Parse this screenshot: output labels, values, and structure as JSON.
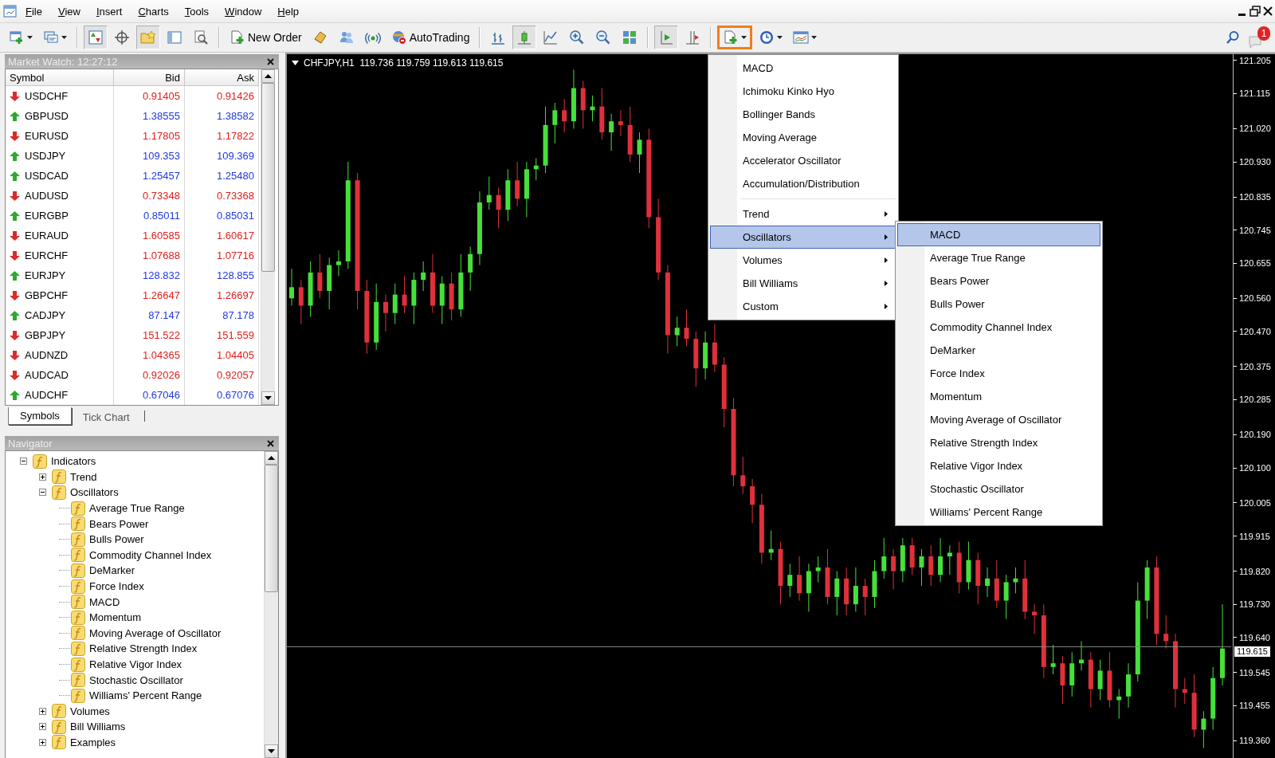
{
  "menu_bar": [
    "File",
    "View",
    "Insert",
    "Charts",
    "Tools",
    "Window",
    "Help"
  ],
  "toolbar": {
    "items": [
      {
        "kind": "icon",
        "dropdown": true,
        "pressed": false,
        "highlighted": false
      },
      {
        "kind": "icon",
        "dropdown": true,
        "pressed": false,
        "highlighted": false
      },
      {
        "kind": "separator"
      },
      {
        "kind": "icon",
        "dropdown": false,
        "pressed": true,
        "highlighted": false
      },
      {
        "kind": "icon",
        "dropdown": false,
        "pressed": false,
        "highlighted": false
      },
      {
        "kind": "icon",
        "dropdown": false,
        "pressed": true,
        "highlighted": false
      },
      {
        "kind": "icon",
        "dropdown": false,
        "pressed": false,
        "highlighted": false
      },
      {
        "kind": "icon",
        "dropdown": false,
        "pressed": false,
        "highlighted": false
      },
      {
        "kind": "separator"
      },
      {
        "kind": "labeled",
        "label": "New Order",
        "dropdown": false,
        "pressed": false,
        "highlighted": false
      },
      {
        "kind": "icon",
        "dropdown": false,
        "pressed": false,
        "highlighted": false
      },
      {
        "kind": "icon",
        "dropdown": false,
        "pressed": false,
        "highlighted": false
      },
      {
        "kind": "icon",
        "dropdown": false,
        "pressed": false,
        "highlighted": false
      },
      {
        "kind": "labeled",
        "label": "AutoTrading",
        "dropdown": false,
        "pressed": false,
        "highlighted": false
      },
      {
        "kind": "separator"
      },
      {
        "kind": "icon",
        "dropdown": false,
        "pressed": false,
        "highlighted": false
      },
      {
        "kind": "icon",
        "dropdown": false,
        "pressed": true,
        "highlighted": false
      },
      {
        "kind": "icon",
        "dropdown": false,
        "pressed": false,
        "highlighted": false
      },
      {
        "kind": "icon",
        "dropdown": false,
        "pressed": false,
        "highlighted": false
      },
      {
        "kind": "icon",
        "dropdown": false,
        "pressed": false,
        "highlighted": false
      },
      {
        "kind": "icon",
        "dropdown": false,
        "pressed": false,
        "highlighted": false
      },
      {
        "kind": "separator"
      },
      {
        "kind": "icon",
        "dropdown": false,
        "pressed": true,
        "highlighted": false
      },
      {
        "kind": "icon",
        "dropdown": false,
        "pressed": false,
        "highlighted": false
      },
      {
        "kind": "separator"
      },
      {
        "kind": "icon",
        "dropdown": true,
        "pressed": false,
        "highlighted": true
      },
      {
        "kind": "icon",
        "dropdown": true,
        "pressed": false,
        "highlighted": false
      },
      {
        "kind": "icon",
        "dropdown": true,
        "pressed": false,
        "highlighted": false
      }
    ]
  },
  "notifications": {
    "count": "1"
  },
  "market_watch": {
    "title": "Market Watch: 12:27:12",
    "columns": [
      "Symbol",
      "Bid",
      "Ask"
    ],
    "rows": [
      {
        "symbol": "USDCHF",
        "bid": "0.91405",
        "ask": "0.91426",
        "kind": "down"
      },
      {
        "symbol": "GBPUSD",
        "bid": "1.38555",
        "ask": "1.38582",
        "kind": "up"
      },
      {
        "symbol": "EURUSD",
        "bid": "1.17805",
        "ask": "1.17822",
        "kind": "down"
      },
      {
        "symbol": "USDJPY",
        "bid": "109.353",
        "ask": "109.369",
        "kind": "up"
      },
      {
        "symbol": "USDCAD",
        "bid": "1.25457",
        "ask": "1.25480",
        "kind": "up"
      },
      {
        "symbol": "AUDUSD",
        "bid": "0.73348",
        "ask": "0.73368",
        "kind": "down"
      },
      {
        "symbol": "EURGBP",
        "bid": "0.85011",
        "ask": "0.85031",
        "kind": "up"
      },
      {
        "symbol": "EURAUD",
        "bid": "1.60585",
        "ask": "1.60617",
        "kind": "down"
      },
      {
        "symbol": "EURCHF",
        "bid": "1.07688",
        "ask": "1.07716",
        "kind": "down"
      },
      {
        "symbol": "EURJPY",
        "bid": "128.832",
        "ask": "128.855",
        "kind": "up"
      },
      {
        "symbol": "GBPCHF",
        "bid": "1.26647",
        "ask": "1.26697",
        "kind": "down"
      },
      {
        "symbol": "CADJPY",
        "bid": "87.147",
        "ask": "87.178",
        "kind": "up"
      },
      {
        "symbol": "GBPJPY",
        "bid": "151.522",
        "ask": "151.559",
        "kind": "down"
      },
      {
        "symbol": "AUDNZD",
        "bid": "1.04365",
        "ask": "1.04405",
        "kind": "down"
      },
      {
        "symbol": "AUDCAD",
        "bid": "0.92026",
        "ask": "0.92057",
        "kind": "down"
      },
      {
        "symbol": "AUDCHF",
        "bid": "0.67046",
        "ask": "0.67076",
        "kind": "up"
      }
    ],
    "tabs": [
      {
        "label": "Symbols",
        "selected": true
      },
      {
        "label": "Tick Chart",
        "selected": false
      }
    ]
  },
  "navigator": {
    "title": "Navigator",
    "tree": [
      {
        "label": "Indicators",
        "expanded": true,
        "children": [
          {
            "label": "Trend",
            "expanded": false
          },
          {
            "label": "Oscillators",
            "expanded": true,
            "children": [
              {
                "label": "Average True Range"
              },
              {
                "label": "Bears Power"
              },
              {
                "label": "Bulls Power"
              },
              {
                "label": "Commodity Channel Index"
              },
              {
                "label": "DeMarker"
              },
              {
                "label": "Force Index"
              },
              {
                "label": "MACD"
              },
              {
                "label": "Momentum"
              },
              {
                "label": "Moving Average of Oscillator"
              },
              {
                "label": "Relative Strength Index"
              },
              {
                "label": "Relative Vigor Index"
              },
              {
                "label": "Stochastic Oscillator"
              },
              {
                "label": "Williams' Percent Range"
              }
            ]
          },
          {
            "label": "Volumes",
            "expanded": false
          },
          {
            "label": "Bill Williams",
            "expanded": false
          },
          {
            "label": "Examples",
            "expanded": false
          }
        ]
      }
    ]
  },
  "chart": {
    "header": "CHFJPY,H1  119.736 119.759 119.613 119.615",
    "current_price": "119.615",
    "chart_data": {
      "type": "candlestick",
      "ylim": [
        119.311,
        121.222
      ],
      "ref_lines": [
        {
          "axis": "y",
          "value": 119.615
        }
      ],
      "categories": [
        null,
        null,
        null,
        null,
        null,
        null,
        null,
        null,
        null,
        null,
        null,
        null,
        null,
        null,
        null,
        null,
        null,
        null,
        null,
        null,
        null,
        null,
        null,
        null,
        null,
        null,
        null,
        null,
        null,
        null,
        null,
        null,
        null,
        null,
        null,
        null,
        null,
        null,
        null,
        null,
        null,
        null,
        null,
        null,
        null,
        null,
        null,
        null,
        null,
        null,
        null,
        null,
        null,
        null,
        null,
        null,
        null,
        null,
        null,
        null,
        null,
        null,
        null,
        null,
        null,
        null,
        null,
        null,
        null,
        null,
        null,
        null,
        null,
        null,
        null,
        null,
        null,
        null,
        null,
        null,
        null,
        null,
        null,
        null,
        null,
        null,
        null,
        null,
        null,
        null,
        null,
        null,
        null,
        null,
        null,
        null,
        null,
        null,
        null,
        null
      ],
      "yticks": [
        {
          "value": 121.205,
          "label": "121.205"
        },
        {
          "value": 121.115,
          "label": "121.115"
        },
        {
          "value": 121.02,
          "label": "121.020"
        },
        {
          "value": 120.93,
          "label": "120.930"
        },
        {
          "value": 120.835,
          "label": "120.835"
        },
        {
          "value": 120.745,
          "label": "120.745"
        },
        {
          "value": 120.655,
          "label": "120.655"
        },
        {
          "value": 120.56,
          "label": "120.560"
        },
        {
          "value": 120.47,
          "label": "120.470"
        },
        {
          "value": 120.375,
          "label": "120.375"
        },
        {
          "value": 120.285,
          "label": "120.285"
        },
        {
          "value": 120.19,
          "label": "120.190"
        },
        {
          "value": 120.1,
          "label": "120.100"
        },
        {
          "value": 120.005,
          "label": "120.005"
        },
        {
          "value": 119.915,
          "label": "119.915"
        },
        {
          "value": 119.82,
          "label": "119.820"
        },
        {
          "value": 119.73,
          "label": "119.730"
        },
        {
          "value": 119.64,
          "label": "119.640"
        },
        {
          "value": 119.545,
          "label": "119.545"
        },
        {
          "value": 119.455,
          "label": "119.455"
        },
        {
          "value": 119.36,
          "label": "119.360"
        }
      ],
      "ohlc": [
        [
          120.56,
          120.64,
          120.54,
          120.59
        ],
        [
          120.59,
          120.61,
          120.49,
          120.54
        ],
        [
          120.54,
          120.66,
          120.51,
          120.63
        ],
        [
          120.63,
          120.68,
          120.56,
          120.58
        ],
        [
          120.58,
          120.67,
          120.53,
          120.65
        ],
        [
          120.65,
          120.69,
          120.62,
          120.66
        ],
        [
          120.66,
          120.93,
          120.64,
          120.88
        ],
        [
          120.88,
          120.9,
          120.53,
          120.58
        ],
        [
          120.58,
          120.61,
          120.41,
          120.44
        ],
        [
          120.44,
          120.6,
          120.42,
          120.55
        ],
        [
          120.55,
          120.57,
          120.47,
          120.52
        ],
        [
          120.52,
          120.6,
          120.49,
          120.57
        ],
        [
          120.57,
          120.62,
          120.52,
          120.54
        ],
        [
          120.54,
          120.63,
          120.49,
          120.61
        ],
        [
          120.61,
          120.66,
          120.58,
          120.63
        ],
        [
          120.63,
          120.68,
          120.52,
          120.54
        ],
        [
          120.54,
          120.62,
          120.49,
          120.6
        ],
        [
          120.6,
          120.63,
          120.5,
          120.53
        ],
        [
          120.53,
          120.68,
          120.51,
          120.63
        ],
        [
          120.63,
          120.7,
          120.58,
          120.68
        ],
        [
          120.68,
          120.85,
          120.65,
          120.82
        ],
        [
          120.82,
          120.89,
          120.8,
          120.84
        ],
        [
          120.84,
          120.86,
          120.75,
          120.8
        ],
        [
          120.8,
          120.91,
          120.77,
          120.88
        ],
        [
          120.88,
          120.93,
          120.81,
          120.83
        ],
        [
          120.83,
          120.93,
          120.78,
          120.91
        ],
        [
          120.91,
          120.94,
          120.88,
          120.92
        ],
        [
          120.92,
          121.08,
          120.9,
          121.03
        ],
        [
          121.03,
          121.09,
          120.98,
          121.07
        ],
        [
          121.07,
          121.1,
          121.01,
          121.04
        ],
        [
          121.04,
          121.18,
          121.02,
          121.13
        ],
        [
          121.13,
          121.15,
          121.02,
          121.07
        ],
        [
          121.07,
          121.11,
          121.04,
          121.08
        ],
        [
          121.08,
          121.13,
          120.99,
          121.01
        ],
        [
          121.01,
          121.06,
          120.96,
          121.04
        ],
        [
          121.04,
          121.07,
          121.0,
          121.03
        ],
        [
          121.03,
          121.08,
          120.93,
          120.95
        ],
        [
          120.95,
          121.01,
          120.9,
          120.99
        ],
        [
          120.99,
          121.02,
          120.75,
          120.78
        ],
        [
          120.78,
          120.83,
          120.61,
          120.63
        ],
        [
          120.63,
          120.65,
          120.41,
          120.46
        ],
        [
          120.46,
          120.51,
          120.43,
          120.48
        ],
        [
          120.48,
          120.53,
          120.43,
          120.45
        ],
        [
          120.45,
          120.47,
          120.32,
          120.37
        ],
        [
          120.37,
          120.47,
          120.34,
          120.44
        ],
        [
          120.44,
          120.49,
          120.36,
          120.38
        ],
        [
          120.38,
          120.4,
          120.21,
          120.26
        ],
        [
          120.26,
          120.29,
          120.05,
          120.08
        ],
        [
          120.08,
          120.13,
          120.03,
          120.05
        ],
        [
          120.05,
          120.07,
          119.95,
          120.0
        ],
        [
          120.0,
          120.03,
          119.84,
          119.87
        ],
        [
          119.87,
          119.93,
          119.85,
          119.88
        ],
        [
          119.88,
          119.9,
          119.73,
          119.78
        ],
        [
          119.78,
          119.84,
          119.75,
          119.81
        ],
        [
          119.81,
          119.86,
          119.74,
          119.76
        ],
        [
          119.76,
          119.84,
          119.71,
          119.82
        ],
        [
          119.82,
          119.86,
          119.79,
          119.83
        ],
        [
          119.83,
          119.88,
          119.73,
          119.75
        ],
        [
          119.75,
          119.82,
          119.7,
          119.8
        ],
        [
          119.8,
          119.83,
          119.7,
          119.73
        ],
        [
          119.73,
          119.83,
          119.71,
          119.78
        ],
        [
          119.78,
          119.8,
          119.7,
          119.75
        ],
        [
          119.75,
          119.85,
          119.72,
          119.82
        ],
        [
          119.82,
          119.91,
          119.8,
          119.86
        ],
        [
          119.86,
          119.88,
          119.77,
          119.82
        ],
        [
          119.82,
          119.91,
          119.79,
          119.89
        ],
        [
          119.89,
          119.91,
          119.81,
          119.83
        ],
        [
          119.83,
          119.88,
          119.78,
          119.86
        ],
        [
          119.86,
          119.89,
          119.78,
          119.81
        ],
        [
          119.81,
          119.91,
          119.79,
          119.86
        ],
        [
          119.86,
          119.89,
          119.81,
          119.87
        ],
        [
          119.87,
          119.9,
          119.76,
          119.79
        ],
        [
          119.79,
          119.9,
          119.77,
          119.85
        ],
        [
          119.85,
          119.87,
          119.73,
          119.78
        ],
        [
          119.78,
          119.83,
          119.75,
          119.8
        ],
        [
          119.8,
          119.85,
          119.72,
          119.74
        ],
        [
          119.74,
          119.81,
          119.69,
          119.79
        ],
        [
          119.79,
          119.83,
          119.76,
          119.8
        ],
        [
          119.8,
          119.85,
          119.69,
          119.71
        ],
        [
          119.71,
          119.73,
          119.65,
          119.7
        ],
        [
          119.7,
          119.73,
          119.53,
          119.56
        ],
        [
          119.56,
          119.62,
          119.54,
          119.57
        ],
        [
          119.57,
          119.59,
          119.46,
          119.51
        ],
        [
          119.51,
          119.6,
          119.48,
          119.57
        ],
        [
          119.57,
          119.63,
          119.55,
          119.58
        ],
        [
          119.58,
          119.6,
          119.45,
          119.5
        ],
        [
          119.5,
          119.58,
          119.47,
          119.55
        ],
        [
          119.55,
          119.6,
          119.45,
          119.47
        ],
        [
          119.47,
          119.5,
          119.42,
          119.48
        ],
        [
          119.48,
          119.57,
          119.45,
          119.54
        ],
        [
          119.54,
          119.79,
          119.52,
          119.74
        ],
        [
          119.74,
          119.85,
          119.69,
          119.83
        ],
        [
          119.83,
          119.86,
          119.62,
          119.65
        ],
        [
          119.65,
          119.7,
          119.61,
          119.63
        ],
        [
          119.63,
          119.65,
          119.45,
          119.5
        ],
        [
          119.5,
          119.53,
          119.46,
          119.49
        ],
        [
          119.49,
          119.54,
          119.37,
          119.39
        ],
        [
          119.39,
          119.44,
          119.34,
          119.42
        ],
        [
          119.42,
          119.56,
          119.39,
          119.53
        ],
        [
          119.53,
          119.73,
          119.51,
          119.61
        ]
      ]
    }
  },
  "indicator_menu": {
    "groups": [
      {
        "items": [
          {
            "label": "MACD",
            "kind": "item",
            "selected": false
          },
          {
            "label": "Ichimoku Kinko Hyo",
            "kind": "item",
            "selected": false
          },
          {
            "label": "Bollinger Bands",
            "kind": "item",
            "selected": false
          },
          {
            "label": "Moving Average",
            "kind": "item",
            "selected": false
          },
          {
            "label": "Accelerator Oscillator",
            "kind": "item",
            "selected": false
          },
          {
            "label": "Accumulation/Distribution",
            "kind": "item",
            "selected": false
          }
        ]
      },
      {
        "items": [
          {
            "label": "Trend",
            "kind": "submenu",
            "selected": false
          },
          {
            "label": "Oscillators",
            "kind": "submenu",
            "selected": true
          },
          {
            "label": "Volumes",
            "kind": "submenu",
            "selected": false
          },
          {
            "label": "Bill Williams",
            "kind": "submenu",
            "selected": false
          },
          {
            "label": "Custom",
            "kind": "submenu",
            "selected": false
          }
        ]
      }
    ]
  },
  "oscillator_submenu": {
    "items": [
      {
        "label": "MACD",
        "selected": true
      },
      {
        "label": "Average True Range",
        "selected": false
      },
      {
        "label": "Bears Power",
        "selected": false
      },
      {
        "label": "Bulls Power",
        "selected": false
      },
      {
        "label": "Commodity Channel Index",
        "selected": false
      },
      {
        "label": "DeMarker",
        "selected": false
      },
      {
        "label": "Force Index",
        "selected": false
      },
      {
        "label": "Momentum",
        "selected": false
      },
      {
        "label": "Moving Average of Oscillator",
        "selected": false
      },
      {
        "label": "Relative Strength Index",
        "selected": false
      },
      {
        "label": "Relative Vigor Index",
        "selected": false
      },
      {
        "label": "Stochastic Oscillator",
        "selected": false
      },
      {
        "label": "Williams' Percent Range",
        "selected": false
      }
    ]
  }
}
